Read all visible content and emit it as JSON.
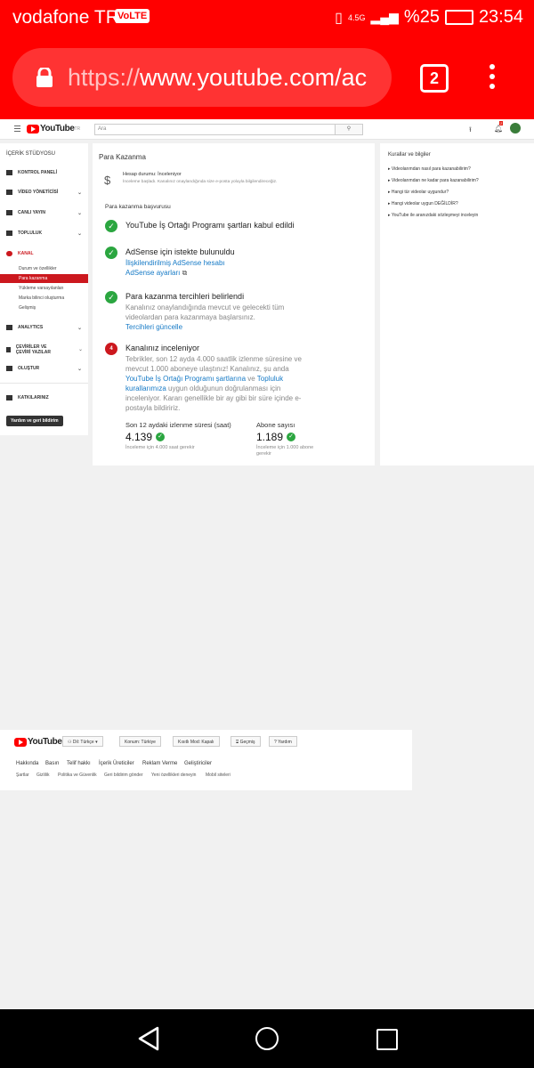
{
  "statusbar": {
    "carrier": "vodafone TR",
    "volte": "VoLTE",
    "network": "4.5G",
    "battery": "%25",
    "time": "23:54"
  },
  "browser": {
    "url_scheme": "https://",
    "url_host": "www.youtube.com/ac",
    "tab_count": "2"
  },
  "header": {
    "logo_text": "YouTube",
    "logo_sup": "TR",
    "search_placeholder": "Ara",
    "notif_count": "2"
  },
  "sidebar": {
    "title": "İÇERİK STÜDYOSU",
    "items": [
      {
        "label": "KONTROL PANELİ"
      },
      {
        "label": "VİDEO YÖNETİCİSİ"
      },
      {
        "label": "CANLI YAYIN"
      },
      {
        "label": "TOPLULUK"
      },
      {
        "label": "KANAL"
      },
      {
        "label": "ANALYTICS"
      },
      {
        "label": "ÇEVİRİLER VE ÇEVİRİ YAZILAR"
      },
      {
        "label": "OLUŞTUR"
      },
      {
        "label": "KATKILARINIZ"
      }
    ],
    "subitems": [
      "Durum ve özellikler",
      "Para kazanma",
      "Yükleme varsayılanları",
      "Marka bilinci oluşturma",
      "Gelişmiş"
    ],
    "feedback": "Yardım ve geri bildirim"
  },
  "main": {
    "title": "Para Kazanma",
    "account_status": "Hesap durumu: İnceleniyor",
    "account_desc": "İnceleme başladı. Kanalınız onaylandığında size e-posta yoluyla bilgilendireceğiz.",
    "apply_title": "Para kazanma başvurusu",
    "step1_title": "YouTube İş Ortağı Programı şartları kabul edildi",
    "step2_title": "AdSense için istekte bulunuldu",
    "step2_link1": "İlişkilendirilmiş AdSense hesabı",
    "step2_link2": "AdSense ayarları",
    "step3_title": "Para kazanma tercihleri belirlendi",
    "step3_desc": "Kanalınız onaylandığında mevcut ve gelecekti tüm videolardan para kazanmaya başlarsınız.",
    "step3_link": "Tercihleri güncelle",
    "step4_num": "4",
    "step4_title": "Kanalınız inceleniyor",
    "step4_desc_a": "Tebrikler, son 12 ayda 4.000 saatlik izlenme süresine ve mevcut 1.000 aboneye ulaştınız! Kanalınız, şu anda ",
    "step4_link1": "YouTube İş Ortağı Programı şartlarına",
    "step4_desc_b": " ve ",
    "step4_link2": "Topluluk kurallarımıza",
    "step4_desc_c": " uygun olduğunun doğrulanması için inceleniyor. Kararı genellikle bir ay gibi bir süre içinde e-postayla bildiririz.",
    "metric1_label": "Son 12 aydaki izlenme süresi (saat)",
    "metric1_value": "4.139",
    "metric1_note": "İnceleme için 4.000 saat gerekir",
    "metric2_label": "Abone sayısı",
    "metric2_value": "1.189",
    "metric2_note": "İnceleme için 1.000 abone gerekir"
  },
  "right": {
    "title": "Kurallar ve bilgiler",
    "links": [
      "Videolarımdan nasıl para kazanabilirim?",
      "Videolarımdan ne kadar para kazanabilirim?",
      "Hangi tür videolar uygundur?",
      "Hangi videolar uygun DEĞİLDİR?",
      "YouTube ile aranızdaki sözleşmeyi inceleyin"
    ]
  },
  "footer": {
    "lang": "Dil: Türkçe",
    "location": "Konum: Türkiye",
    "restricted": "Kısıtlı Mod: Kapalı",
    "history": "Geçmiş",
    "help": "Yardım",
    "links1": [
      "Hakkında",
      "Basın",
      "Telif hakkı",
      "İçerik Üreticiler",
      "Reklam Verme",
      "Geliştiriciler"
    ],
    "links2": [
      "Şartlar",
      "Gizlilik",
      "Politika ve Güvenlik",
      "Geri bildirim gönder",
      "Yeni özellikleri deneyin",
      "Mobil siteleri"
    ]
  }
}
